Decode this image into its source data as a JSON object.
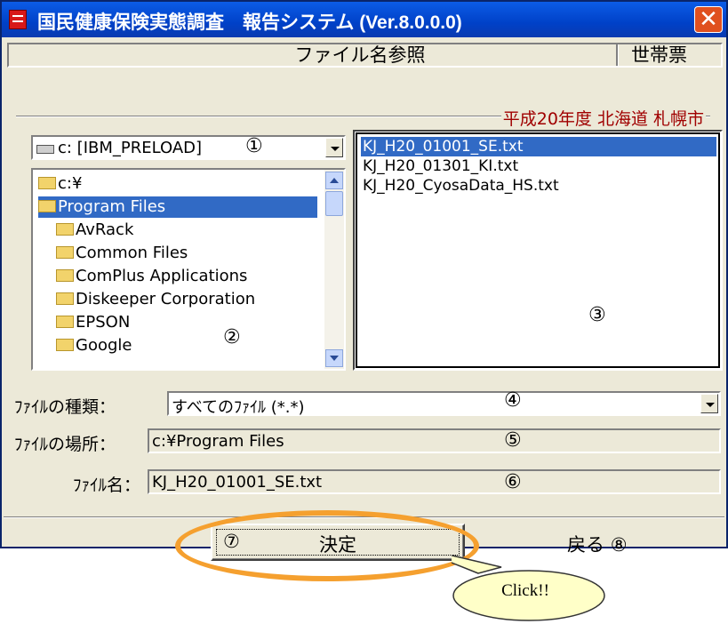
{
  "window": {
    "title": "国民健康保険実態調査　報告システム (Ver.8.0.0.0)",
    "close_glyph": "✕"
  },
  "header": {
    "title": "ファイル名参照",
    "right_label": "世帯票"
  },
  "group_label": "平成20年度 北海道 札幌市",
  "drive": {
    "value": "c: [IBM_PRELOAD]",
    "marker": "①"
  },
  "folders": {
    "marker": "②",
    "items": [
      {
        "label": "c:¥",
        "selected": false
      },
      {
        "label": "Program Files",
        "selected": true
      },
      {
        "label": "AvRack",
        "selected": false
      },
      {
        "label": "Common Files",
        "selected": false
      },
      {
        "label": "ComPlus Applications",
        "selected": false
      },
      {
        "label": "Diskeeper Corporation",
        "selected": false
      },
      {
        "label": "EPSON",
        "selected": false
      },
      {
        "label": "Google",
        "selected": false
      }
    ]
  },
  "files": {
    "marker": "③",
    "items": [
      {
        "label": "KJ_H20_01001_SE.txt",
        "selected": true
      },
      {
        "label": "KJ_H20_01301_KI.txt",
        "selected": false
      },
      {
        "label": "KJ_H20_CyosaData_HS.txt",
        "selected": false
      }
    ]
  },
  "file_type": {
    "label": "ﾌｧｲﾙの種類：",
    "value": "すべてのﾌｧｲﾙ (*.*)",
    "marker": "④"
  },
  "file_location": {
    "label": "ﾌｧｲﾙの場所：",
    "value": "c:¥Program Files",
    "marker": "⑤"
  },
  "file_name": {
    "label": "ﾌｧｲﾙ名：",
    "value": "KJ_H20_01001_SE.txt",
    "marker": "⑥"
  },
  "buttons": {
    "ok": {
      "marker": "⑦",
      "label": "決定"
    },
    "back": {
      "label": "戻る",
      "marker": "⑧"
    }
  },
  "callout": {
    "text": "Click!!"
  },
  "colors": {
    "titlebar": "#0041c8",
    "group_label": "#a00000",
    "selection": "#316ac5",
    "highlight_ring": "#f5a02f",
    "callout_fill": "#ffffc8"
  }
}
